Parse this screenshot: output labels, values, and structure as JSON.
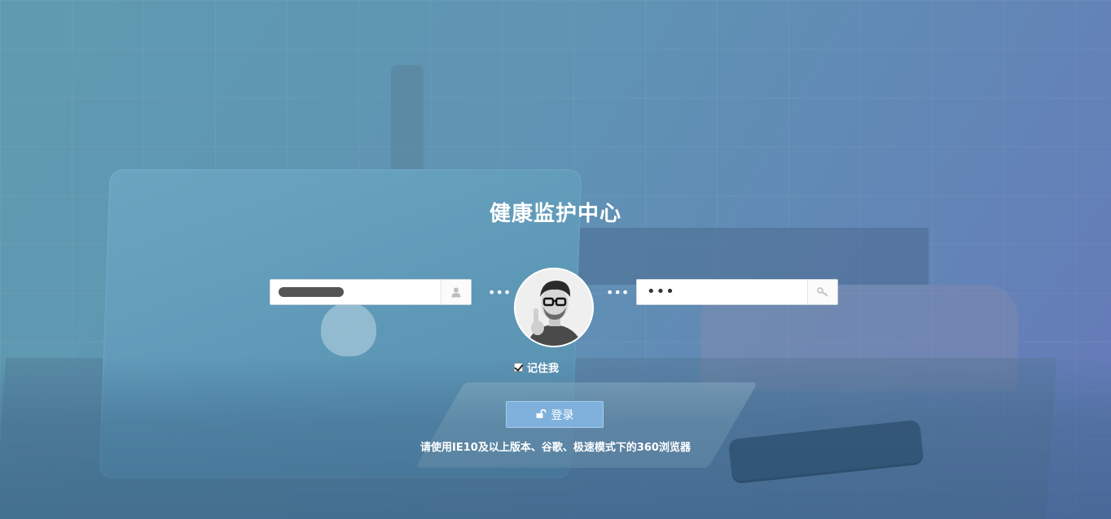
{
  "page": {
    "title": "健康监护中心",
    "hint": "请使用IE10及以上版本、谷歌、极速模式下的360浏览器"
  },
  "login_form": {
    "username": {
      "value": "",
      "icon": "user-icon"
    },
    "password": {
      "masked_value": "•••",
      "icon": "key-icon"
    },
    "separator": "•••",
    "avatar": "avatar-photo",
    "remember_me": {
      "label": "记住我",
      "checked": true
    },
    "login_button": {
      "label": "登录",
      "icon": "unlock-icon"
    }
  },
  "colors": {
    "background_start": "#5f9bb0",
    "background_end": "#6579b9",
    "button": "#7fb1dc",
    "text": "#ffffff"
  }
}
